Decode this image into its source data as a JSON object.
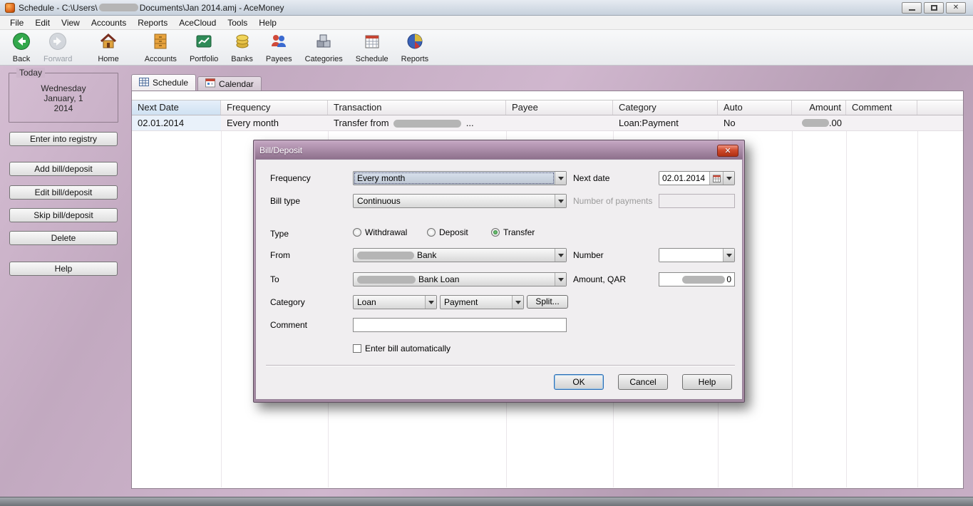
{
  "window": {
    "title_prefix": "Schedule - C:\\Users\\",
    "title_suffix": "Documents\\Jan 2014.amj - AceMoney",
    "close_glyph": "✕"
  },
  "menu": {
    "items": [
      "File",
      "Edit",
      "View",
      "Accounts",
      "Reports",
      "AceCloud",
      "Tools",
      "Help"
    ]
  },
  "toolbar": {
    "buttons": [
      {
        "label": "Back"
      },
      {
        "label": "Forward"
      },
      {
        "label": "Home"
      },
      {
        "label": "Accounts"
      },
      {
        "label": "Portfolio"
      },
      {
        "label": "Banks"
      },
      {
        "label": "Payees"
      },
      {
        "label": "Categories"
      },
      {
        "label": "Schedule"
      },
      {
        "label": "Reports"
      }
    ]
  },
  "sidebar": {
    "today_label": "Today",
    "today_lines": [
      "Wednesday",
      "January, 1",
      "2014"
    ],
    "buttons": [
      "Enter into registry",
      "Add bill/deposit",
      "Edit bill/deposit",
      "Skip bill/deposit",
      "Delete",
      "Help"
    ]
  },
  "tabs": [
    {
      "label": "Schedule"
    },
    {
      "label": "Calendar"
    }
  ],
  "table": {
    "headers": [
      "Next Date",
      "Frequency",
      "Transaction",
      "Payee",
      "Category",
      "Auto",
      "Amount",
      "Comment"
    ],
    "row": {
      "next_date": "02.01.2014",
      "frequency": "Every month",
      "transaction_prefix": "Transfer from",
      "transaction_suffix": "...",
      "payee": "",
      "category": "Loan:Payment",
      "auto": "No",
      "amount_suffix": ".00",
      "comment": ""
    }
  },
  "dialog": {
    "title": "Bill/Deposit",
    "close_glyph": "✕",
    "labels": {
      "frequency": "Frequency",
      "next_date": "Next date",
      "bill_type": "Bill type",
      "number_of_payments": "Number of payments",
      "type": "Type",
      "from": "From",
      "number": "Number",
      "to": "To",
      "amount": "Amount, QAR",
      "category": "Category",
      "comment": "Comment"
    },
    "values": {
      "frequency": "Every month",
      "next_date": "02.01.2014",
      "bill_type": "Continuous",
      "number_of_payments": "",
      "from_suffix": "Bank",
      "to_suffix": "Bank Loan",
      "number": "",
      "amount_suffix": "0",
      "category_1": "Loan",
      "category_2": "Payment",
      "comment": ""
    },
    "type_options": [
      "Withdrawal",
      "Deposit",
      "Transfer"
    ],
    "type_selected": "Transfer",
    "auto_check_label": "Enter bill automatically",
    "auto_checked": false,
    "buttons": {
      "split": "Split...",
      "ok": "OK",
      "cancel": "Cancel",
      "help": "Help"
    }
  },
  "colors": {
    "dialog_title": "#8e718c",
    "app_background": "#c3aac1",
    "close_button_red": "#b03014",
    "selected_header": "#cfe1f2"
  }
}
